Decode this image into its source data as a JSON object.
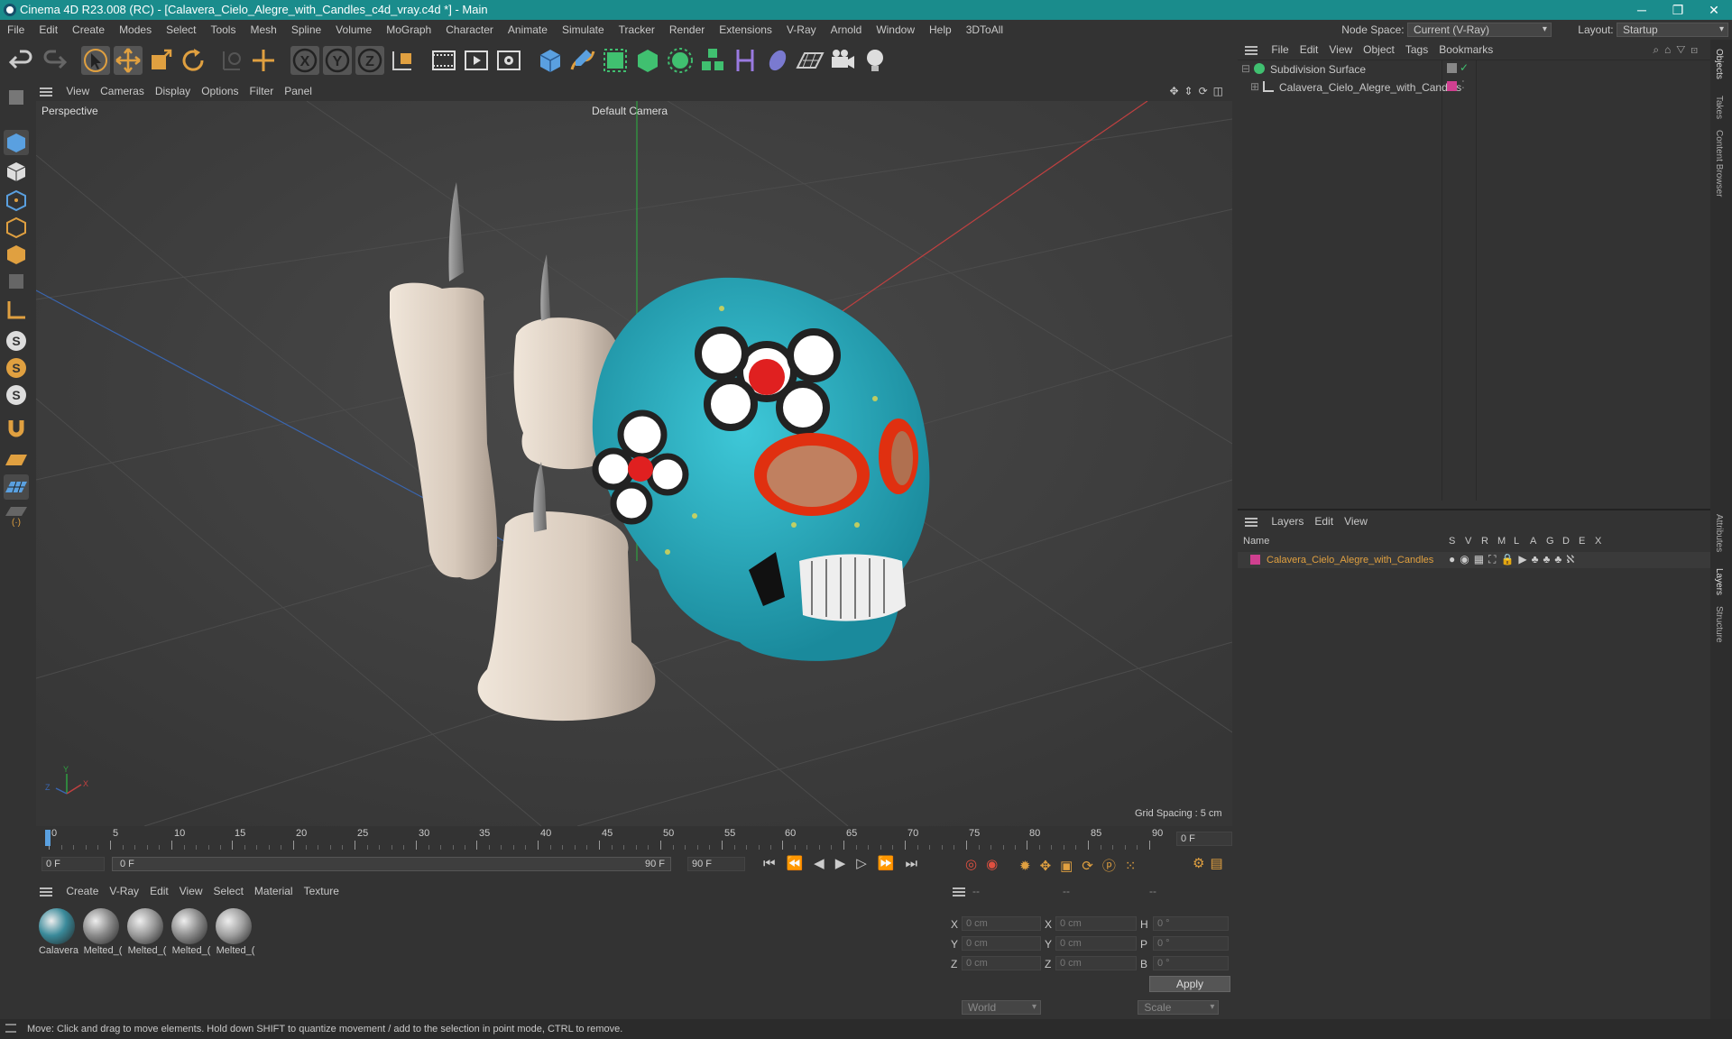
{
  "window": {
    "title": "Cinema 4D R23.008 (RC) - [Calavera_Cielo_Alegre_with_Candles_c4d_vray.c4d *] - Main"
  },
  "menubar": {
    "items": [
      "File",
      "Edit",
      "Create",
      "Modes",
      "Select",
      "Tools",
      "Mesh",
      "Spline",
      "Volume",
      "MoGraph",
      "Character",
      "Animate",
      "Simulate",
      "Tracker",
      "Render",
      "Extensions",
      "V-Ray",
      "Arnold",
      "Window",
      "Help",
      "3DToAll"
    ],
    "node_space_label": "Node Space:",
    "node_space_value": "Current (V-Ray)",
    "layout_label": "Layout:",
    "layout_value": "Startup"
  },
  "viewport": {
    "menu": [
      "View",
      "Cameras",
      "Display",
      "Options",
      "Filter",
      "Panel"
    ],
    "label": "Perspective",
    "camera": "Default Camera",
    "grid_spacing": "Grid Spacing : 5 cm"
  },
  "timeline": {
    "ticks": [
      "0",
      "5",
      "10",
      "15",
      "20",
      "25",
      "30",
      "35",
      "40",
      "45",
      "50",
      "55",
      "60",
      "65",
      "70",
      "75",
      "80",
      "85",
      "90"
    ],
    "current_frame": "0 F"
  },
  "transport": {
    "start": "0 F",
    "range_start": "0 F",
    "range_end": "90 F",
    "end": "90 F"
  },
  "material_panel": {
    "menu": [
      "Create",
      "V-Ray",
      "Edit",
      "View",
      "Select",
      "Material",
      "Texture"
    ],
    "materials": [
      {
        "name": "Calavera",
        "color": "#3a8a9a"
      },
      {
        "name": "Melted_(",
        "color": "#8a8a8a"
      },
      {
        "name": "Melted_(",
        "color": "#9a9a9a"
      },
      {
        "name": "Melted_(",
        "color": "#8d8d8d"
      },
      {
        "name": "Melted_(",
        "color": "#a0a0a0"
      }
    ]
  },
  "coordinates": {
    "header": [
      "--",
      "--",
      "--"
    ],
    "rows": [
      {
        "a": "X",
        "v1": "0 cm",
        "b": "X",
        "v2": "0 cm",
        "c": "H",
        "v3": "0 °"
      },
      {
        "a": "Y",
        "v1": "0 cm",
        "b": "Y",
        "v2": "0 cm",
        "c": "P",
        "v3": "0 °"
      },
      {
        "a": "Z",
        "v1": "0 cm",
        "b": "Z",
        "v2": "0 cm",
        "c": "B",
        "v3": "0 °"
      }
    ],
    "world": "World",
    "scale": "Scale",
    "apply": "Apply"
  },
  "object_manager": {
    "menu": [
      "File",
      "Edit",
      "View",
      "Object",
      "Tags",
      "Bookmarks"
    ],
    "objects": [
      {
        "name": "Subdivision Surface"
      },
      {
        "name": "Calavera_Cielo_Alegre_with_Candles"
      }
    ]
  },
  "layer_manager": {
    "menu": [
      "Layers",
      "Edit",
      "View"
    ],
    "columns": [
      "Name",
      "S",
      "V",
      "R",
      "M",
      "L",
      "A",
      "G",
      "D",
      "E",
      "X"
    ],
    "layers": [
      {
        "name": "Calavera_Cielo_Alegre_with_Candles",
        "color": "#d04090"
      }
    ]
  },
  "side_tabs": [
    "Objects",
    "Takes",
    "Content Browser",
    "Attributes",
    "Layers",
    "Structure"
  ],
  "status": "Move: Click and drag to move elements. Hold down SHIFT to quantize movement / add to the selection in point mode, CTRL to remove.",
  "colors": {
    "titlebar": "#1a8c8c",
    "accent": "#e0a040"
  }
}
